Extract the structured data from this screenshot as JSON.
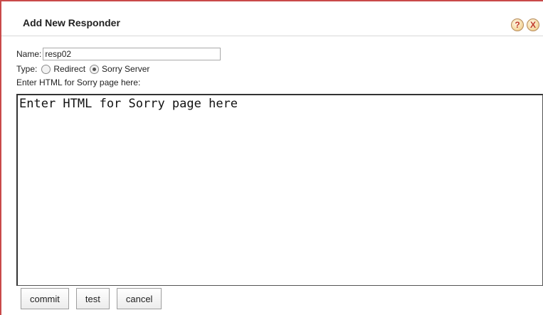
{
  "dialog": {
    "title": "Add New Responder",
    "help_icon_glyph": "?",
    "close_icon_glyph": "X"
  },
  "form": {
    "name_label": "Name:",
    "name_value": "resp02",
    "type_label": "Type:",
    "type_options": [
      {
        "label": "Redirect",
        "selected": false
      },
      {
        "label": "Sorry Server",
        "selected": true
      }
    ],
    "html_label": "Enter HTML for Sorry page here:",
    "html_value": "Enter HTML for Sorry page here"
  },
  "buttons": {
    "commit": "commit",
    "test": "test",
    "cancel": "cancel"
  },
  "colors": {
    "frame_border": "#c94a4a",
    "icon_fill": "#f3d59a",
    "icon_text": "#c0392b"
  },
  "icons": [
    "help-icon",
    "close-icon"
  ]
}
